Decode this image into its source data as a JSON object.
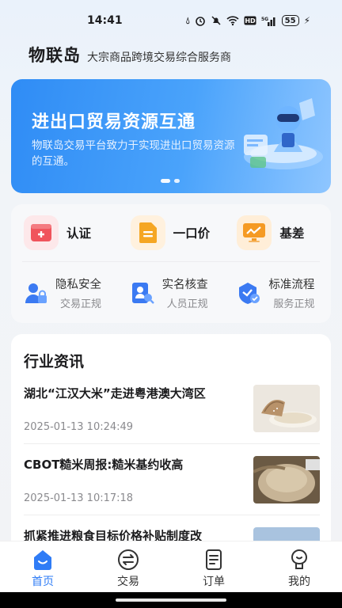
{
  "status_bar": {
    "time": "14:41",
    "battery": "55",
    "icons": [
      "drop-icon",
      "alarm-icon",
      "mute-icon",
      "wifi-icon",
      "hd-icon",
      "signal-icon",
      "battery-icon",
      "charging-icon"
    ]
  },
  "header": {
    "brand": "物联岛",
    "tagline": "大宗商品跨境交易综合服务商"
  },
  "banner": {
    "title": "进出口贸易资源互通",
    "description": "物联岛交易平台致力于实现进出口贸易资源的互通。",
    "slides_total": 2,
    "active_slide": 1
  },
  "services": {
    "main": [
      {
        "label": "认证",
        "icon": "certification-icon",
        "color": "#f0545c"
      },
      {
        "label": "一口价",
        "icon": "document-icon",
        "color": "#f5a623"
      },
      {
        "label": "基差",
        "icon": "chart-monitor-icon",
        "color": "#f59a23"
      }
    ],
    "sub": [
      {
        "title": "隐私安全",
        "subtitle": "交易正规",
        "icon": "privacy-lock-icon"
      },
      {
        "title": "实名核查",
        "subtitle": "人员正规",
        "icon": "id-check-icon"
      },
      {
        "title": "标准流程",
        "subtitle": "服务正规",
        "icon": "process-shield-icon"
      }
    ]
  },
  "news": {
    "heading": "行业资讯",
    "items": [
      {
        "title": "湖北“江汉大米”走进粤港澳大湾区",
        "time": "2025-01-13 10:24:49"
      },
      {
        "title": "CBOT糙米周报:糙米基约收高",
        "time": "2025-01-13 10:17:18"
      },
      {
        "title": "抓紧推进粮食目标价格补贴制度改",
        "time": ""
      }
    ]
  },
  "tab_bar": {
    "tabs": [
      {
        "label": "首页",
        "icon": "home-icon",
        "active": true
      },
      {
        "label": "交易",
        "icon": "exchange-icon",
        "active": false
      },
      {
        "label": "订单",
        "icon": "order-icon",
        "active": false
      },
      {
        "label": "我的",
        "icon": "profile-icon",
        "active": false
      }
    ]
  },
  "colors": {
    "accent": "#2f7cf6",
    "banner_start": "#2f8cf5",
    "banner_end": "#8fc6ff"
  }
}
